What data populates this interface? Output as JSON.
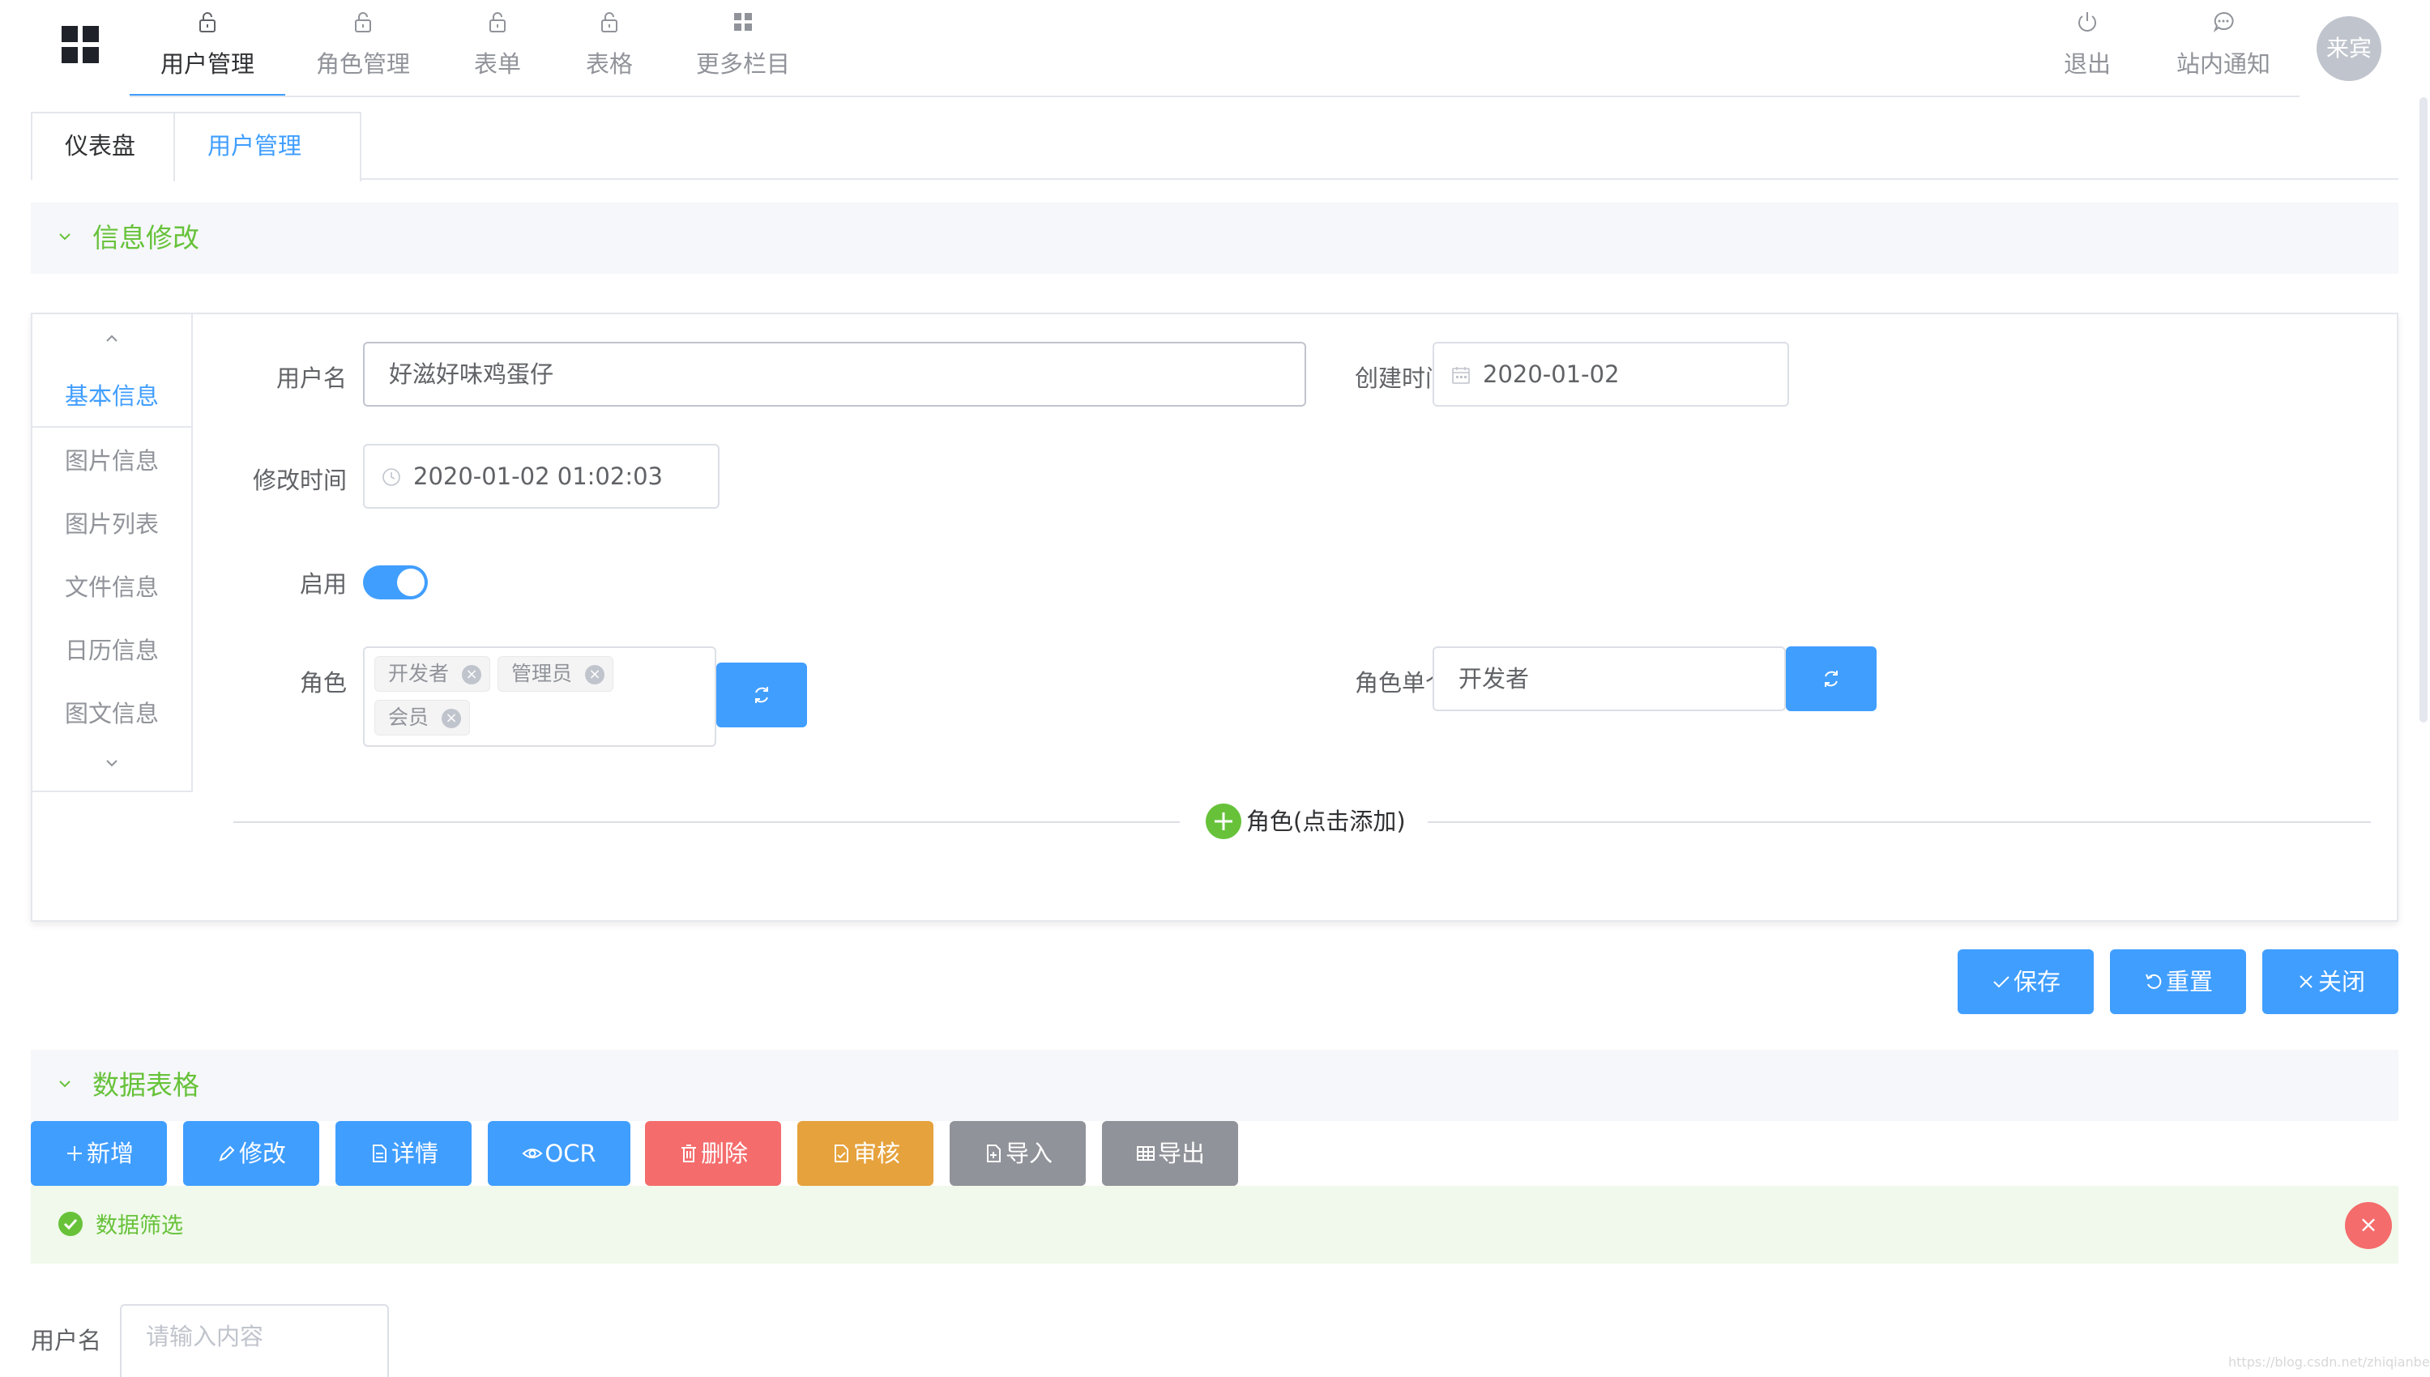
{
  "nav": {
    "items": [
      {
        "label": "用户管理",
        "icon": "lock-icon",
        "active": true
      },
      {
        "label": "角色管理",
        "icon": "lock-icon"
      },
      {
        "label": "表单",
        "icon": "lock-icon"
      },
      {
        "label": "表格",
        "icon": "lock-icon"
      },
      {
        "label": "更多栏目",
        "icon": "grid-icon"
      }
    ],
    "logout_label": "退出",
    "notify_label": "站内通知",
    "avatar_text": "来宾",
    "accent_color": "#409eff"
  },
  "tabs": [
    {
      "label": "仪表盘"
    },
    {
      "label": "用户管理",
      "active": true,
      "close": "×"
    }
  ],
  "section_form": {
    "title": "信息修改"
  },
  "side_menu": {
    "items": [
      {
        "label": "基本信息",
        "active": true
      },
      {
        "label": "图片信息"
      },
      {
        "label": "图片列表"
      },
      {
        "label": "文件信息"
      },
      {
        "label": "日历信息"
      },
      {
        "label": "图文信息"
      }
    ]
  },
  "form": {
    "username_label": "用户名",
    "username_value": "好滋好味鸡蛋仔",
    "created_label": "创建时间",
    "created_value": "2020-01-02",
    "modified_label": "修改时间",
    "modified_value": "2020-01-02 01:02:03",
    "enabled_label": "启用",
    "enabled": true,
    "roles_label": "角色",
    "roles": [
      "开发者",
      "管理员",
      "会员"
    ],
    "tag_close": "×",
    "single_role_label": "角色单个",
    "single_role_value": "开发者",
    "add_role_label": "角色(点击添加)"
  },
  "form_actions": {
    "save": "保存",
    "reset": "重置",
    "close": "关闭"
  },
  "section_table": {
    "title": "数据表格"
  },
  "toolbar": {
    "add": "新增",
    "edit": "修改",
    "detail": "详情",
    "ocr": "OCR",
    "delete": "删除",
    "audit": "审核",
    "import": "导入",
    "export": "导出"
  },
  "filter": {
    "alert_text": "数据筛选",
    "alert_close": "×",
    "username_label": "用户名",
    "username_placeholder": "请输入内容"
  },
  "watermark": "https://blog.csdn.net/zhiqianbeifeng"
}
